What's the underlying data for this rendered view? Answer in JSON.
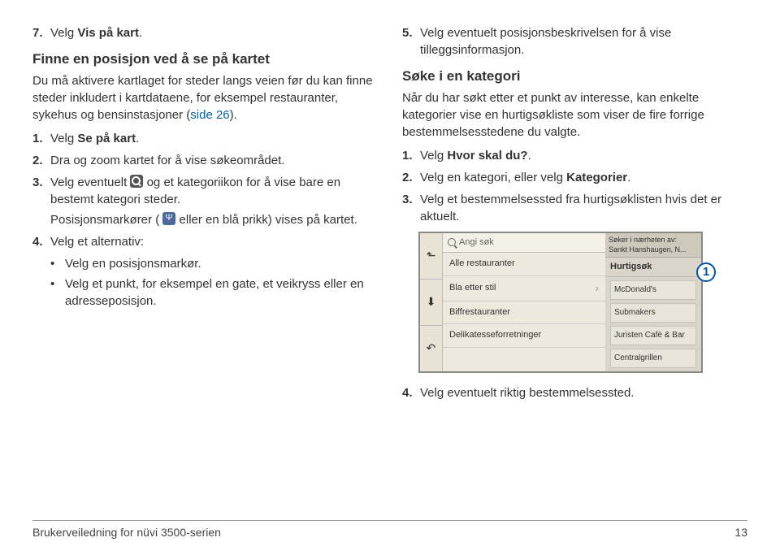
{
  "left": {
    "item7_num": "7.",
    "item7_prefix": "Velg ",
    "item7_bold": "Vis på kart",
    "item7_suffix": ".",
    "heading1": "Finne en posisjon ved å se på kartet",
    "para1_a": "Du må aktivere kartlaget for steder langs veien før du kan finne steder inkludert i kartdataene, for eksempel restauranter, sykehus og bensinstasjoner (",
    "para1_link": "side 26",
    "para1_b": ").",
    "s1_num": "1.",
    "s1_prefix": "Velg ",
    "s1_bold": "Se på kart",
    "s1_suffix": ".",
    "s2_num": "2.",
    "s2_text": "Dra og zoom kartet for å vise søkeområdet.",
    "s3_num": "3.",
    "s3_a": "Velg eventuelt ",
    "s3_b": " og et kategoriikon for å vise bare en bestemt kategori steder.",
    "s3_p2a": "Posisjonsmarkører (",
    "s3_p2b": " eller en blå prikk) vises på kartet.",
    "s4_num": "4.",
    "s4_text": "Velg et alternativ:",
    "s4_b1": "Velg en posisjonsmarkør.",
    "s4_b2": "Velg et punkt, for eksempel en gate, et veikryss eller en adresseposisjon."
  },
  "right": {
    "s5_num": "5.",
    "s5_text": "Velg eventuelt posisjonsbeskrivelsen for å vise tilleggsinformasjon.",
    "heading2": "Søke i en kategori",
    "para2": "Når du har søkt etter et punkt av interesse, kan enkelte kategorier vise en hurtigsøkliste som viser de fire forrige bestemmelsesstedene du valgte.",
    "r1_num": "1.",
    "r1_prefix": "Velg ",
    "r1_bold": "Hvor skal du?",
    "r1_suffix": ".",
    "r2_num": "2.",
    "r2_prefix": "Velg en kategori, eller velg ",
    "r2_bold": "Kategorier",
    "r2_suffix": ".",
    "r3_num": "3.",
    "r3_text": "Velg et bestemmelsessted fra hurtigsøklisten hvis det er aktuelt.",
    "r4_num": "4.",
    "r4_text": "Velg eventuelt riktig bestemmelsessted."
  },
  "device": {
    "search_placeholder": "Angi søk",
    "list": [
      "Alle restauranter",
      "Bla etter stil",
      "Biffrestauranter",
      "Delikatesseforretninger"
    ],
    "rhead_a": "Søker i nærheten av:",
    "rhead_b": "Sankt Hanshaugen, N...",
    "rtitle": "Hurtigsøk",
    "ritems": [
      "McDonald's",
      "Submakers",
      "Juristen Cafè & Bar",
      "Centralgrillen"
    ],
    "callout": "1"
  },
  "footer": {
    "left": "Brukerveiledning for nüvi 3500-serien",
    "right": "13"
  }
}
